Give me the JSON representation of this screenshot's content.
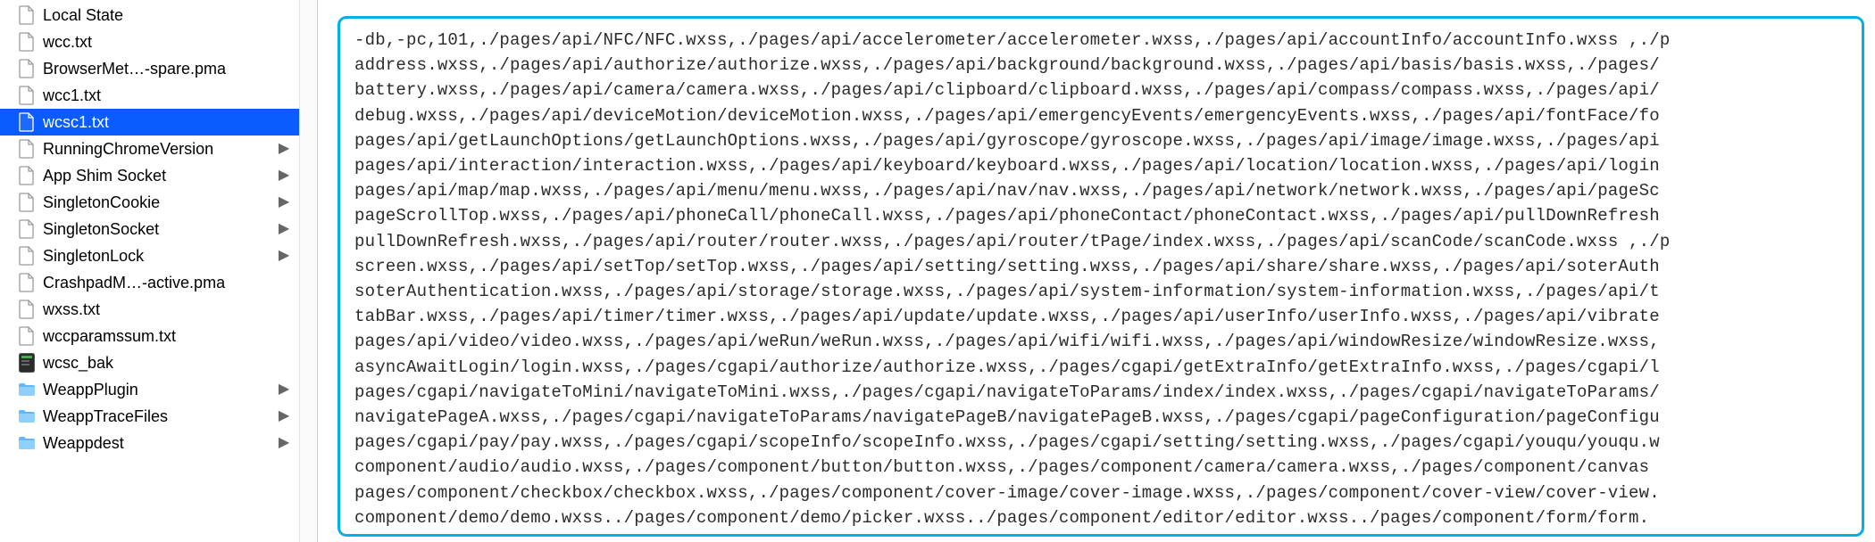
{
  "sidebar": {
    "items": [
      {
        "label": "Local State",
        "icon": "doc-blank",
        "hasChildren": false
      },
      {
        "label": "wcc.txt",
        "icon": "doc-blank",
        "hasChildren": false
      },
      {
        "label": "BrowserMet…-spare.pma",
        "icon": "doc-blank",
        "hasChildren": false
      },
      {
        "label": "wcc1.txt",
        "icon": "doc-blank",
        "hasChildren": false
      },
      {
        "label": "wcsc1.txt",
        "icon": "doc-blank",
        "hasChildren": false,
        "selected": true
      },
      {
        "label": "RunningChromeVersion",
        "icon": "doc-blank",
        "hasChildren": true
      },
      {
        "label": "App Shim Socket",
        "icon": "doc-blank",
        "hasChildren": true
      },
      {
        "label": "SingletonCookie",
        "icon": "doc-blank",
        "hasChildren": true
      },
      {
        "label": "SingletonSocket",
        "icon": "doc-blank",
        "hasChildren": true
      },
      {
        "label": "SingletonLock",
        "icon": "doc-blank",
        "hasChildren": true
      },
      {
        "label": "CrashpadM…-active.pma",
        "icon": "doc-blank",
        "hasChildren": false
      },
      {
        "label": "wxss.txt",
        "icon": "doc-blank",
        "hasChildren": false
      },
      {
        "label": "wccparamssum.txt",
        "icon": "doc-blank",
        "hasChildren": false
      },
      {
        "label": "wcsc_bak",
        "icon": "exec",
        "hasChildren": false
      },
      {
        "label": "WeappPlugin",
        "icon": "folder",
        "hasChildren": true
      },
      {
        "label": "WeappTraceFiles",
        "icon": "folder",
        "hasChildren": true
      },
      {
        "label": "Weappdest",
        "icon": "folder",
        "hasChildren": true
      }
    ]
  },
  "content": {
    "lines": [
      "-db,-pc,101,./pages/api/NFC/NFC.wxss,./pages/api/accelerometer/accelerometer.wxss,./pages/api/accountInfo/accountInfo.wxss ,./p",
      "address.wxss,./pages/api/authorize/authorize.wxss,./pages/api/background/background.wxss,./pages/api/basis/basis.wxss,./pages/",
      "battery.wxss,./pages/api/camera/camera.wxss,./pages/api/clipboard/clipboard.wxss,./pages/api/compass/compass.wxss,./pages/api/",
      "debug.wxss,./pages/api/deviceMotion/deviceMotion.wxss,./pages/api/emergencyEvents/emergencyEvents.wxss,./pages/api/fontFace/fo",
      "pages/api/getLaunchOptions/getLaunchOptions.wxss,./pages/api/gyroscope/gyroscope.wxss,./pages/api/image/image.wxss,./pages/api",
      "pages/api/interaction/interaction.wxss,./pages/api/keyboard/keyboard.wxss,./pages/api/location/location.wxss,./pages/api/login",
      "pages/api/map/map.wxss,./pages/api/menu/menu.wxss,./pages/api/nav/nav.wxss,./pages/api/network/network.wxss,./pages/api/pageSc",
      "pageScrollTop.wxss,./pages/api/phoneCall/phoneCall.wxss,./pages/api/phoneContact/phoneContact.wxss,./pages/api/pullDownRefresh",
      "pullDownRefresh.wxss,./pages/api/router/router.wxss,./pages/api/router/tPage/index.wxss,./pages/api/scanCode/scanCode.wxss ,./p",
      "screen.wxss,./pages/api/setTop/setTop.wxss,./pages/api/setting/setting.wxss,./pages/api/share/share.wxss,./pages/api/soterAuth",
      "soterAuthentication.wxss,./pages/api/storage/storage.wxss,./pages/api/system-information/system-information.wxss,./pages/api/t",
      "tabBar.wxss,./pages/api/timer/timer.wxss,./pages/api/update/update.wxss,./pages/api/userInfo/userInfo.wxss,./pages/api/vibrate",
      "pages/api/video/video.wxss,./pages/api/weRun/weRun.wxss,./pages/api/wifi/wifi.wxss,./pages/api/windowResize/windowResize.wxss,",
      "asyncAwaitLogin/login.wxss,./pages/cgapi/authorize/authorize.wxss,./pages/cgapi/getExtraInfo/getExtraInfo.wxss,./pages/cgapi/l",
      "pages/cgapi/navigateToMini/navigateToMini.wxss,./pages/cgapi/navigateToParams/index/index.wxss,./pages/cgapi/navigateToParams/",
      "navigatePageA.wxss,./pages/cgapi/navigateToParams/navigatePageB/navigatePageB.wxss,./pages/cgapi/pageConfiguration/pageConfigu",
      "pages/cgapi/pay/pay.wxss,./pages/cgapi/scopeInfo/scopeInfo.wxss,./pages/cgapi/setting/setting.wxss,./pages/cgapi/youqu/youqu.w",
      "component/audio/audio.wxss,./pages/component/button/button.wxss,./pages/component/camera/camera.wxss,./pages/component/canvas",
      "pages/component/checkbox/checkbox.wxss,./pages/component/cover-image/cover-image.wxss,./pages/component/cover-view/cover-view.",
      "component/demo/demo.wxss../pages/component/demo/picker.wxss../pages/component/editor/editor.wxss../pages/component/form/form."
    ]
  },
  "icons": {
    "chevron": "▶"
  }
}
